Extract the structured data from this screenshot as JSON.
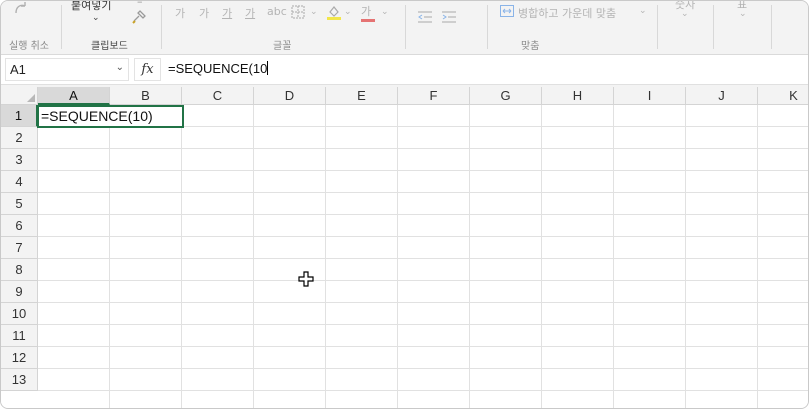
{
  "ribbon": {
    "undo_group_label": "실행 취소",
    "clipboard": {
      "paste_label": "붙여넣기",
      "group_label": "클립보드"
    },
    "font": {
      "grow_label": "가",
      "shrink_label": "가",
      "underline_label": "가",
      "strike_label": "가",
      "font_color_label": "가",
      "group_label": "글꼴"
    },
    "alignment": {
      "merge_label": "병합하고 가운데 맞춤",
      "group_label": "맞춤"
    },
    "number": {
      "format_label": "숫자"
    },
    "styles": {
      "label": "표"
    }
  },
  "formula_bar": {
    "name_box": "A1",
    "fx_label": "fx",
    "formula": "=SEQUENCE(10"
  },
  "sheet": {
    "columns": [
      "A",
      "B",
      "C",
      "D",
      "E",
      "F",
      "G",
      "H",
      "I",
      "J",
      "K"
    ],
    "rows": [
      "1",
      "2",
      "3",
      "4",
      "5",
      "6",
      "7",
      "8",
      "9",
      "10",
      "11",
      "12",
      "13"
    ],
    "active_cell_text": "=SEQUENCE(10)"
  },
  "colors": {
    "accent": "#217346",
    "gridline": "#e1e1e1",
    "header_bg": "#f3f3f3"
  },
  "icons": [
    "redo-icon",
    "format-painter-icon",
    "borders-icon",
    "fill-color-icon",
    "indent-icon",
    "merge-icon",
    "move-cursor-icon"
  ]
}
